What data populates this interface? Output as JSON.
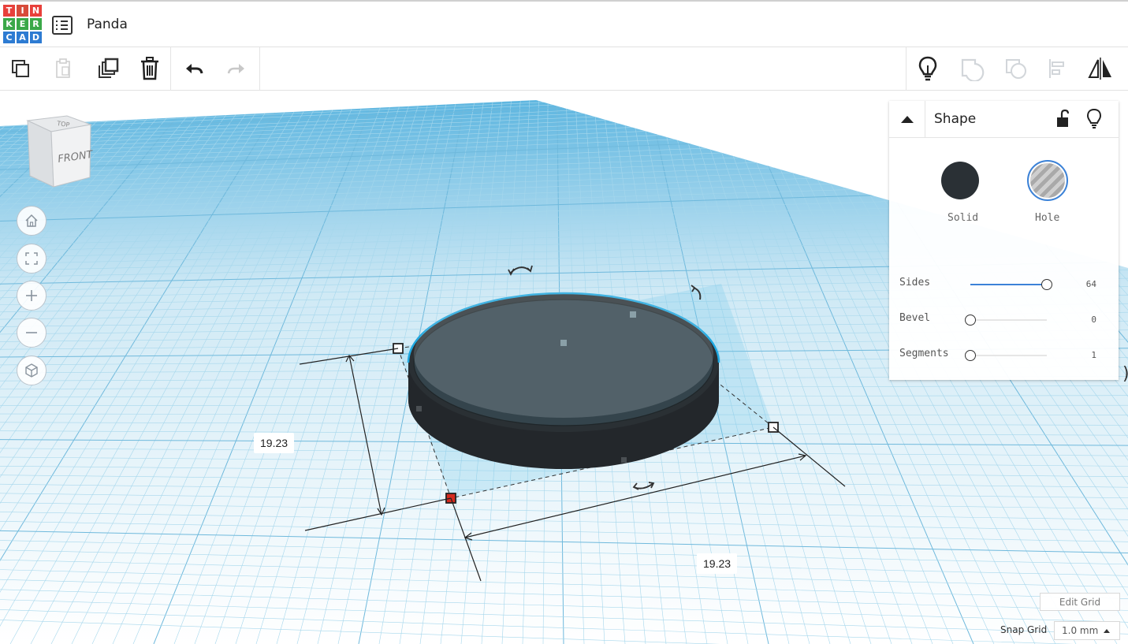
{
  "app": {
    "logo_letters": [
      "T",
      "I",
      "N",
      "K",
      "E",
      "R",
      "C",
      "A",
      "D"
    ],
    "logo_colors": [
      "#e8403b",
      "#d74b3a",
      "#e8403b",
      "#3aa848",
      "#3aa848",
      "#3aa848",
      "#2d7bd2",
      "#2d7bd2",
      "#2d7bd2"
    ],
    "menu_icon": "list-menu-icon",
    "document_title": "Panda"
  },
  "toolbar": {
    "left_tools": [
      {
        "name": "copy-button",
        "icon": "copy-icon",
        "enabled": true
      },
      {
        "name": "paste-button",
        "icon": "paste-icon",
        "enabled": false
      },
      {
        "name": "duplicate-button",
        "icon": "duplicate-icon",
        "enabled": true
      },
      {
        "name": "delete-button",
        "icon": "trash-icon",
        "enabled": true
      },
      {
        "name": "undo-button",
        "icon": "undo-arrow-icon",
        "enabled": true
      },
      {
        "name": "redo-button",
        "icon": "redo-arrow-icon",
        "enabled": false
      }
    ],
    "right_tools": [
      {
        "name": "show-all-button",
        "icon": "lightbulb-icon",
        "enabled": true
      },
      {
        "name": "group-button",
        "icon": "group-icon",
        "enabled": false
      },
      {
        "name": "ungroup-button",
        "icon": "ungroup-icon",
        "enabled": false
      },
      {
        "name": "align-button",
        "icon": "align-icon",
        "enabled": false
      },
      {
        "name": "mirror-button",
        "icon": "mirror-icon",
        "enabled": true
      }
    ]
  },
  "viewcube": {
    "top_label": "TOP",
    "front_label": "FRONT"
  },
  "nav_controls": [
    {
      "name": "home-view-button",
      "icon": "home-icon"
    },
    {
      "name": "fit-view-button",
      "icon": "fit-icon"
    },
    {
      "name": "zoom-in-button",
      "icon": "plus-icon"
    },
    {
      "name": "zoom-out-button",
      "icon": "minus-icon"
    },
    {
      "name": "perspective-button",
      "icon": "cube-icon"
    }
  ],
  "dimensions": {
    "depth": "19.23",
    "width": "19.23"
  },
  "inspector": {
    "title": "Shape",
    "lock_icon": "unlock-icon",
    "bulb_icon": "lightbulb-icon",
    "solid_label": "Solid",
    "hole_label": "Hole",
    "selected": "Hole",
    "properties": [
      {
        "label": "Sides",
        "value": "64",
        "fraction": 1.0
      },
      {
        "label": "Bevel",
        "value": "0",
        "fraction": 0.0
      },
      {
        "label": "Segments",
        "value": "1",
        "fraction": 0.0
      }
    ]
  },
  "grid": {
    "edit_grid_label": "Edit Grid",
    "snap_label": "Snap Grid",
    "snap_value": "1.0 mm"
  },
  "colors": {
    "accent": "#3b82d8",
    "grid_line": "#8fcde8",
    "shape_fill": "#2a3035",
    "selection_outline": "#29a8dc",
    "handle_active": "#d42a1e"
  }
}
